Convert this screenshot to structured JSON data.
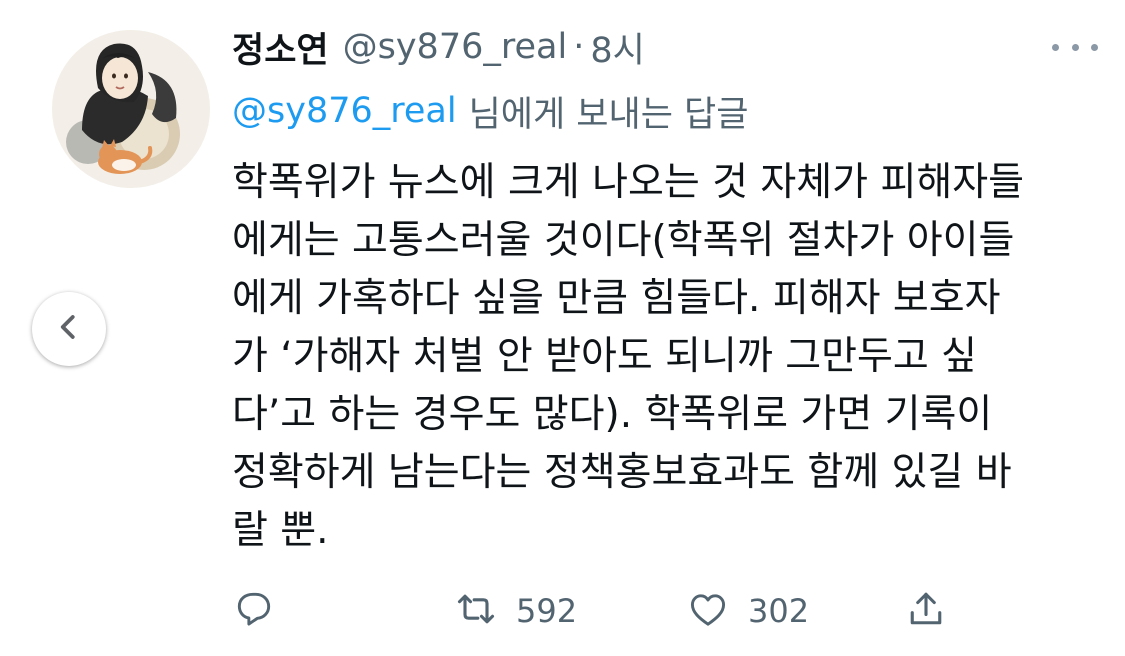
{
  "tweet": {
    "display_name": "정소연",
    "handle": "@sy876_real",
    "separator": "·",
    "timestamp": "8시",
    "reply_to_handle": "@sy876_real",
    "reply_to_suffix": "님에게 보내는 답글",
    "body_lines": [
      "학폭위가 뉴스에 크게 나오는 것 자체가 피해자들",
      "에게는 고통스러울 것이다(학폭위 절차가 아이들",
      "에게 가혹하다 싶을 만큼 힘들다. 피해자 보호자",
      "가 ‘가해자 처벌 안 받아도 되니까 그만두고 싶",
      "다’고 하는 경우도 많다). 학폭위로 가면 기록이",
      "정확하게 남는다는 정책홍보효과도 함께 있길 바",
      "랄 뿐."
    ]
  },
  "actions": {
    "reply_icon": "reply-icon",
    "retweet_icon": "retweet-icon",
    "retweet_count": "592",
    "like_icon": "heart-icon",
    "like_count": "302",
    "share_icon": "share-icon"
  },
  "colors": {
    "text": "#0f1419",
    "secondary": "#536471",
    "link": "#1d9bf0",
    "icon": "#536471"
  }
}
